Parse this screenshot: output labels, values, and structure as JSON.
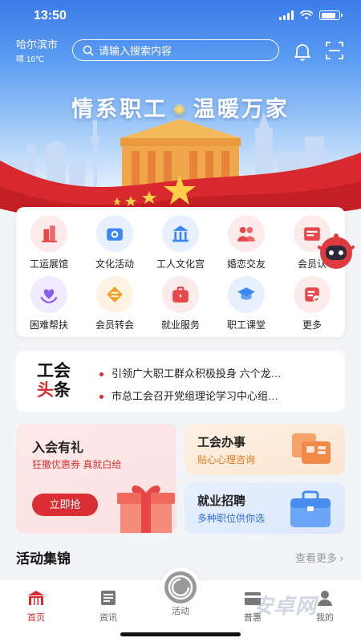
{
  "status": {
    "time": "13:50"
  },
  "header": {
    "city": "哈尔滨市",
    "weather": "晴 16℃",
    "search_placeholder": "请输入搜索内容"
  },
  "banner": {
    "slogan_left": "情系职工",
    "slogan_right": "温暖万家"
  },
  "grid": [
    {
      "label": "工运展馆",
      "icon": "building-icon",
      "color": "#e8474a"
    },
    {
      "label": "文化活动",
      "icon": "camera-icon",
      "color": "#3a86f2"
    },
    {
      "label": "工人文化宫",
      "icon": "palace-icon",
      "color": "#3a86f2"
    },
    {
      "label": "婚恋交友",
      "icon": "couple-icon",
      "color": "#e8474a"
    },
    {
      "label": "会员认",
      "icon": "member-icon",
      "color": "#e8474a"
    },
    {
      "label": "困难帮扶",
      "icon": "heart-hand-icon",
      "color": "#8a5cf0"
    },
    {
      "label": "会员转会",
      "icon": "transfer-icon",
      "color": "#f2a020"
    },
    {
      "label": "就业服务",
      "icon": "briefcase-icon",
      "color": "#e8474a"
    },
    {
      "label": "职工课堂",
      "icon": "graduation-cap-icon",
      "color": "#3a86f2"
    },
    {
      "label": "更多",
      "icon": "more-icon",
      "color": "#e8474a"
    }
  ],
  "news": {
    "logo_line1": "工会",
    "logo_line2_red": "头",
    "logo_line2_black": "条",
    "items": [
      "引领广大职工群众积极投身 六个龙…",
      "市总工会召开党组理论学习中心组…"
    ]
  },
  "promos": {
    "join": {
      "title": "入会有礼",
      "sub": "狂撒优惠券 真就白给",
      "button": "立即抢"
    },
    "affairs": {
      "title": "工会办事",
      "sub": "贴心心理咨询"
    },
    "jobs": {
      "title": "就业招聘",
      "sub": "多种职位供你选"
    }
  },
  "section": {
    "title": "活动集锦",
    "more": "查看更多"
  },
  "tabs": [
    {
      "label": "首页",
      "icon": "home-icon"
    },
    {
      "label": "资讯",
      "icon": "news-icon"
    },
    {
      "label": "活动",
      "icon": "activity-icon"
    },
    {
      "label": "普惠",
      "icon": "benefit-icon"
    },
    {
      "label": "我的",
      "icon": "profile-icon"
    }
  ],
  "watermark": "安卓网"
}
